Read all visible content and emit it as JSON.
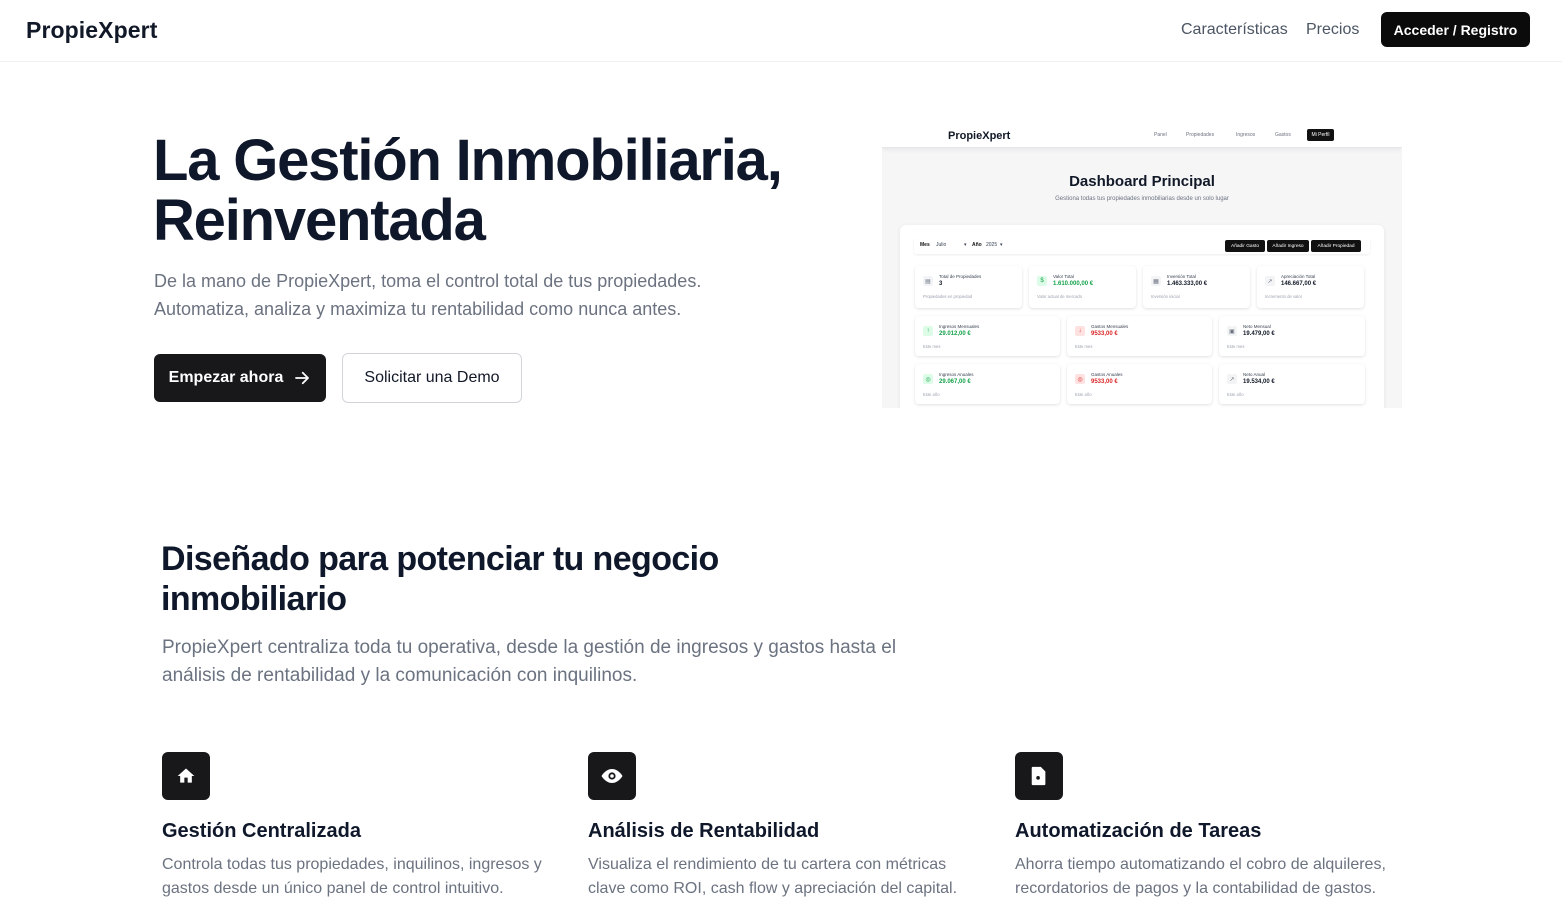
{
  "nav": {
    "brand": "PropieXpert",
    "links": [
      "Características",
      "Precios"
    ],
    "cta": "Acceder / Registro"
  },
  "hero": {
    "title_line1": "La Gestión Inmobiliaria,",
    "title_line2": "Reinventada",
    "subtitle_line1": "De la mano de PropieXpert, toma el control total de tus propiedades.",
    "subtitle_line2": "Automatiza, analiza y maximiza tu rentabilidad como nunca antes.",
    "primary_button": "Empezar ahora",
    "secondary_button": "Solicitar una Demo"
  },
  "preview": {
    "brand": "PropieXpert",
    "links": [
      "Panel",
      "Propiedades",
      "Ingresos",
      "Gastos"
    ],
    "profile_button": "Mi Perfil",
    "heading": "Dashboard Principal",
    "description": "Gestiona todas tus propiedades inmobiliarias desde un solo lugar",
    "filters": {
      "month_label": "Mes",
      "month_value": "Julio",
      "year_label": "Año",
      "year_value": "2025"
    },
    "actions": [
      "Añadir Gasto",
      "Añadir Ingreso",
      "Añadir Propiedad"
    ],
    "row1": [
      {
        "title": "Total de Propiedades",
        "value": "3",
        "sub": "Propiedades en propiedad",
        "tone": "neutral"
      },
      {
        "title": "Valor Total",
        "value": "1.610.000,00 €",
        "sub": "Valor actual de mercado",
        "tone": "green"
      },
      {
        "title": "Inversión Total",
        "value": "1.463.333,00 €",
        "sub": "Inversión inicial",
        "tone": "neutral"
      },
      {
        "title": "Apreciación Total",
        "value": "146.667,00 €",
        "sub": "Incremento de valor",
        "tone": "neutral"
      }
    ],
    "row2": [
      {
        "title": "Ingresos Mensuales",
        "value": "29.012,00 €",
        "sub": "Este mes",
        "tone": "green"
      },
      {
        "title": "Gastos Mensuales",
        "value": "9533,00 €",
        "sub": "Este mes",
        "tone": "red"
      },
      {
        "title": "Neto Mensual",
        "value": "19.479,00 €",
        "sub": "Este mes",
        "tone": "neutral"
      }
    ],
    "row3": [
      {
        "title": "Ingresos Anuales",
        "value": "29.067,00 €",
        "sub": "Este año",
        "tone": "green"
      },
      {
        "title": "Gastos Anuales",
        "value": "9533,00 €",
        "sub": "Este año",
        "tone": "red"
      },
      {
        "title": "Neto Anual",
        "value": "19.534,00 €",
        "sub": "Este año",
        "tone": "neutral"
      }
    ]
  },
  "features_section": {
    "title_line1": "Diseñado para potenciar tu negocio",
    "title_line2": "inmobiliario",
    "subtitle_line1": "PropieXpert centraliza toda tu operativa, desde la gestión de ingresos y gastos hasta el",
    "subtitle_line2": "análisis de rentabilidad y la comunicación con inquilinos.",
    "items": [
      {
        "icon": "home-icon",
        "title": "Gestión Centralizada",
        "text_line1": "Controla todas tus propiedades, inquilinos, ingresos y",
        "text_line2": "gastos desde un único panel de control intuitivo."
      },
      {
        "icon": "eye-icon",
        "title": "Análisis de Rentabilidad",
        "text_line1": "Visualiza el rendimiento de tu cartera con métricas",
        "text_line2": "clave como ROI, cash flow y apreciación del capital."
      },
      {
        "icon": "file-icon",
        "title": "Automatización de Tareas",
        "text_line1": "Ahorra tiempo automatizando el cobro de alquileres,",
        "text_line2": "recordatorios de pagos y la contabilidad de gastos."
      }
    ]
  }
}
